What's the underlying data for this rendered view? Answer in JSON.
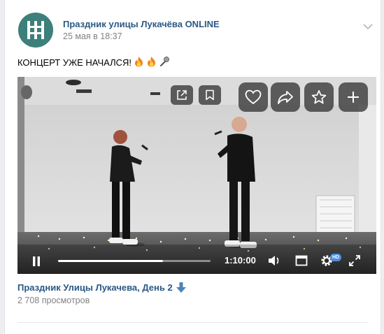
{
  "post": {
    "author": "Праздник улицы Лукачёва ONLINE",
    "date": "25 мая в 18:37",
    "text": "КОНЦЕРТ УЖЕ НАЧАЛСЯ!",
    "emojis": [
      "fire",
      "fire",
      "microphone"
    ]
  },
  "video": {
    "title": "Праздник Улицы Лукачева, День 2",
    "views": "2 708 просмотров",
    "timecode": "1:10:00",
    "progress": 0.69,
    "quality_badge": "HD"
  },
  "icons": {
    "share": "share-icon",
    "save": "bookmark-icon",
    "like": "heart-icon",
    "repost": "repost-arrow-icon",
    "favorite": "star-icon",
    "add": "plus-icon",
    "pause": "pause-icon",
    "volume": "volume-icon",
    "miniplayer": "miniplayer-icon",
    "settings": "gear-icon",
    "fullscreen": "fullscreen-icon",
    "download": "arrow-down-icon",
    "menu": "chevron-down-icon"
  },
  "colors": {
    "link": "#2a5885",
    "muted": "#828282",
    "avatar": "#3d7f7b",
    "accent": "#4a8fe0"
  }
}
